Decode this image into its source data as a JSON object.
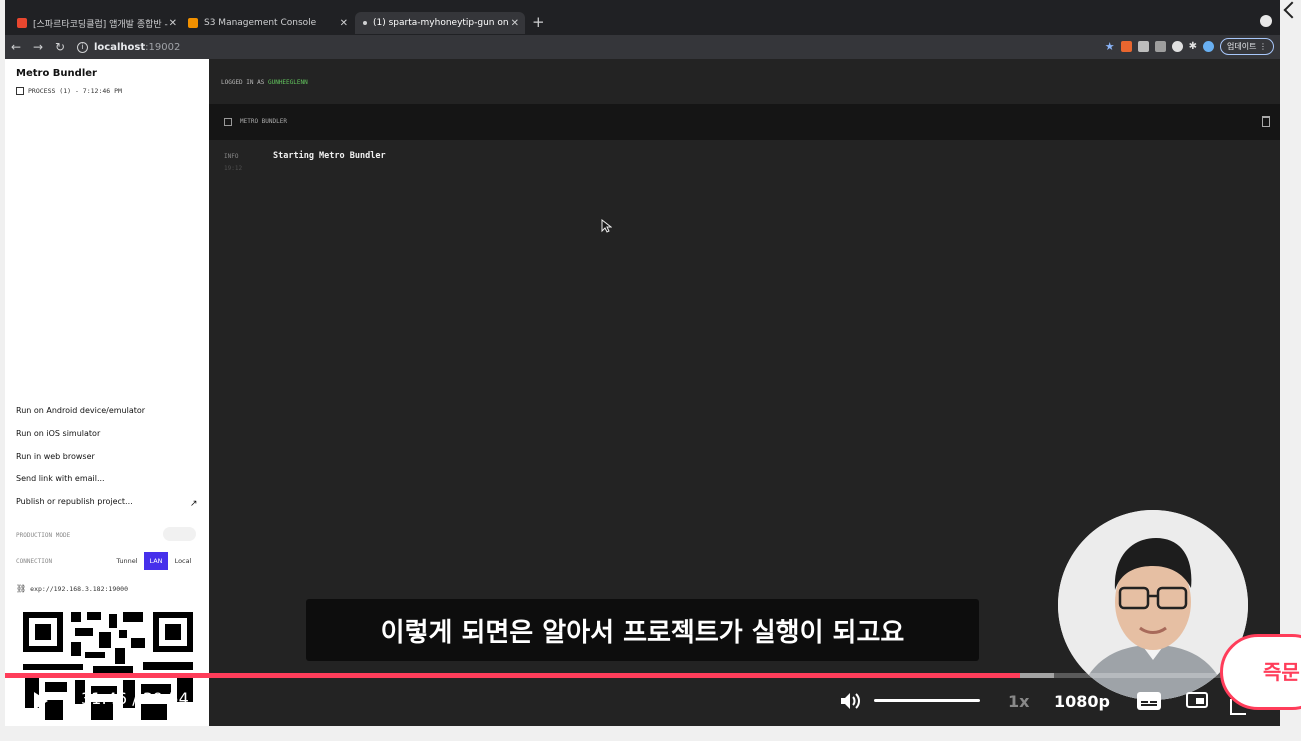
{
  "browser": {
    "tabs": [
      {
        "label": "[스파르타코딩클럽] 앱개발 종합반 -",
        "favicon_color": "#e8472f"
      },
      {
        "label": "S3 Management Console",
        "favicon_color": "#f29100"
      },
      {
        "label": "(1) sparta-myhoneytip-gun on",
        "favicon_color": "#cfd0d2"
      }
    ],
    "url_host": "localhost",
    "url_port": ":19002",
    "update_label": "업데이트"
  },
  "sidebar": {
    "title": "Metro Bundler",
    "process": "PROCESS (1) - 7:12:46 PM",
    "actions": [
      "Run on Android device/emulator",
      "Run on iOS simulator",
      "Run in web browser",
      "Send link with email...",
      "Publish or republish project..."
    ],
    "production_mode_label": "PRODUCTION MODE",
    "connection_label": "CONNECTION",
    "connection_options": [
      "Tunnel",
      "LAN",
      "Local"
    ],
    "connection_selected": "LAN",
    "exp_url": "exp://192.168.3.182:19000"
  },
  "main": {
    "logged_in_prefix": "LOGGED IN AS",
    "logged_in_user": "GUNHEEGLENN",
    "panel_title": "METRO BUNDLER",
    "log": {
      "level": "INFO",
      "time": "19:12",
      "message": "Starting Metro Bundler"
    }
  },
  "video": {
    "subtitle": "이렇게 되면은 알아서 프로젝트가 실행이 되고요",
    "current_time": "31:46 /",
    "duration": "39:54",
    "played_fraction": 0.796,
    "buffered_fraction": 0.823,
    "volume_fraction": 1.0,
    "speed": "1x",
    "quality": "1080p",
    "side_pill_text": "즉문",
    "accent_color": "#ff3d5a"
  }
}
